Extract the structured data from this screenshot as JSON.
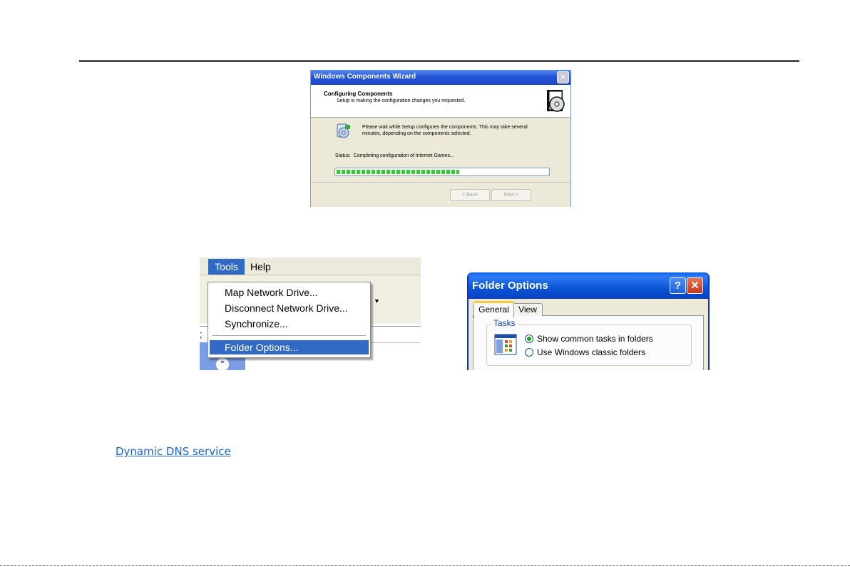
{
  "wizard": {
    "title": "Windows Components Wizard",
    "heading": "Configuring Components",
    "subheading": "Setup is making the configuration changes you requested.",
    "message": "Please wait while Setup configures the components. This may take several minutes, depending on the components selected.",
    "status_label": "Status:",
    "status_text": "Completing configuration of Internet Games...",
    "progress": 0.58,
    "back_label": "< Back",
    "next_label": "Next >",
    "close_glyph": "×"
  },
  "menu": {
    "tools_label": "Tools",
    "help_label": "Help",
    "items": [
      {
        "label": "Map Network Drive..."
      },
      {
        "label": "Disconnect Network Drive..."
      },
      {
        "label": "Synchronize..."
      },
      {
        "label": "Folder Options..."
      }
    ],
    "selected_item": "Folder Options...",
    "highlight_color": "#316ac5"
  },
  "folder_options": {
    "title": "Folder Options",
    "help_glyph": "?",
    "close_glyph": "✕",
    "tabs": [
      {
        "label": "General",
        "active": true
      },
      {
        "label": "View",
        "active": false
      }
    ],
    "group_label": "Tasks",
    "options": [
      {
        "label": "Show common tasks in folders",
        "selected": true
      },
      {
        "label": "Use Windows classic folders",
        "selected": false
      }
    ]
  },
  "link": {
    "text": "Dynamic DNS service",
    "color": "#1a63d9"
  },
  "icons": [
    "close-icon",
    "wizard-cd-icon",
    "setup-computer-icon",
    "chevron-up-icon",
    "dropdown-arrow-icon",
    "help-icon",
    "tasks-icon"
  ]
}
